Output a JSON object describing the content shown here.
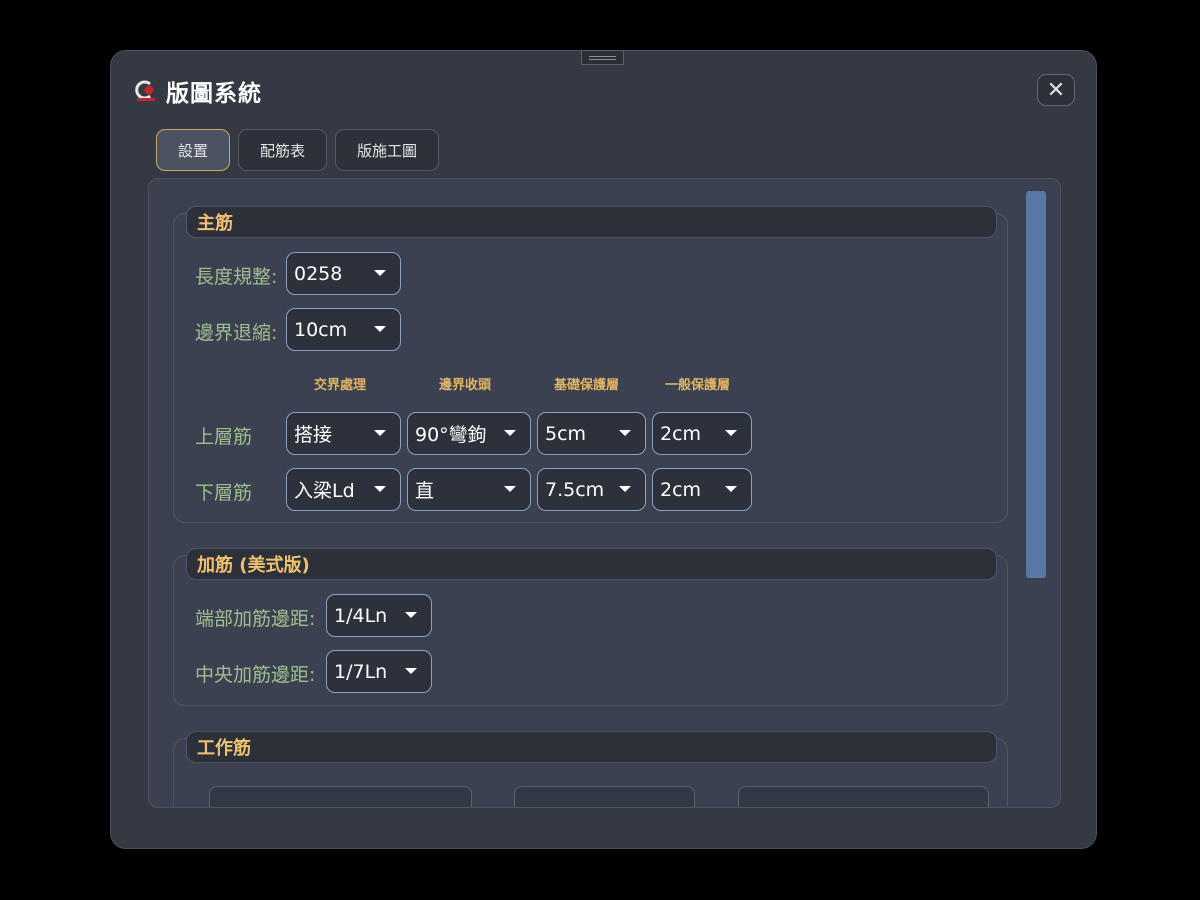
{
  "app": {
    "title": "版圖系統"
  },
  "tabs": [
    {
      "label": "設置",
      "active": true
    },
    {
      "label": "配筋表",
      "active": false
    },
    {
      "label": "版施工圖",
      "active": false
    }
  ],
  "main_bar": {
    "title": "主筋",
    "length_label": "長度規整:",
    "length_value": "0258",
    "edge_label": "邊界退縮:",
    "edge_value": "10cm",
    "columns": [
      "交界處理",
      "邊界收頭",
      "基礎保護層",
      "一般保護層"
    ],
    "rows": [
      {
        "label": "上層筋",
        "values": [
          "搭接",
          "90°彎鉤",
          "5cm",
          "2cm"
        ]
      },
      {
        "label": "下層筋",
        "values": [
          "入梁Ld",
          "直",
          "7.5cm",
          "2cm"
        ]
      }
    ]
  },
  "extra_bar": {
    "title": "加筋 (美式版)",
    "end_label": "端部加筋邊距:",
    "end_value": "1/4Ln",
    "center_label": "中央加筋邊距:",
    "center_value": "1/7Ln"
  },
  "work_bar": {
    "title": "工作筋"
  },
  "colors": {
    "accent": "#f0c270",
    "label_green": "#9fbe8f",
    "scrollbar": "#5879a6",
    "active_tab_border": "#c8a766"
  },
  "icons": {
    "close": "close-icon",
    "logo": "app-logo-icon",
    "dropdown": "chevron-down-icon"
  }
}
